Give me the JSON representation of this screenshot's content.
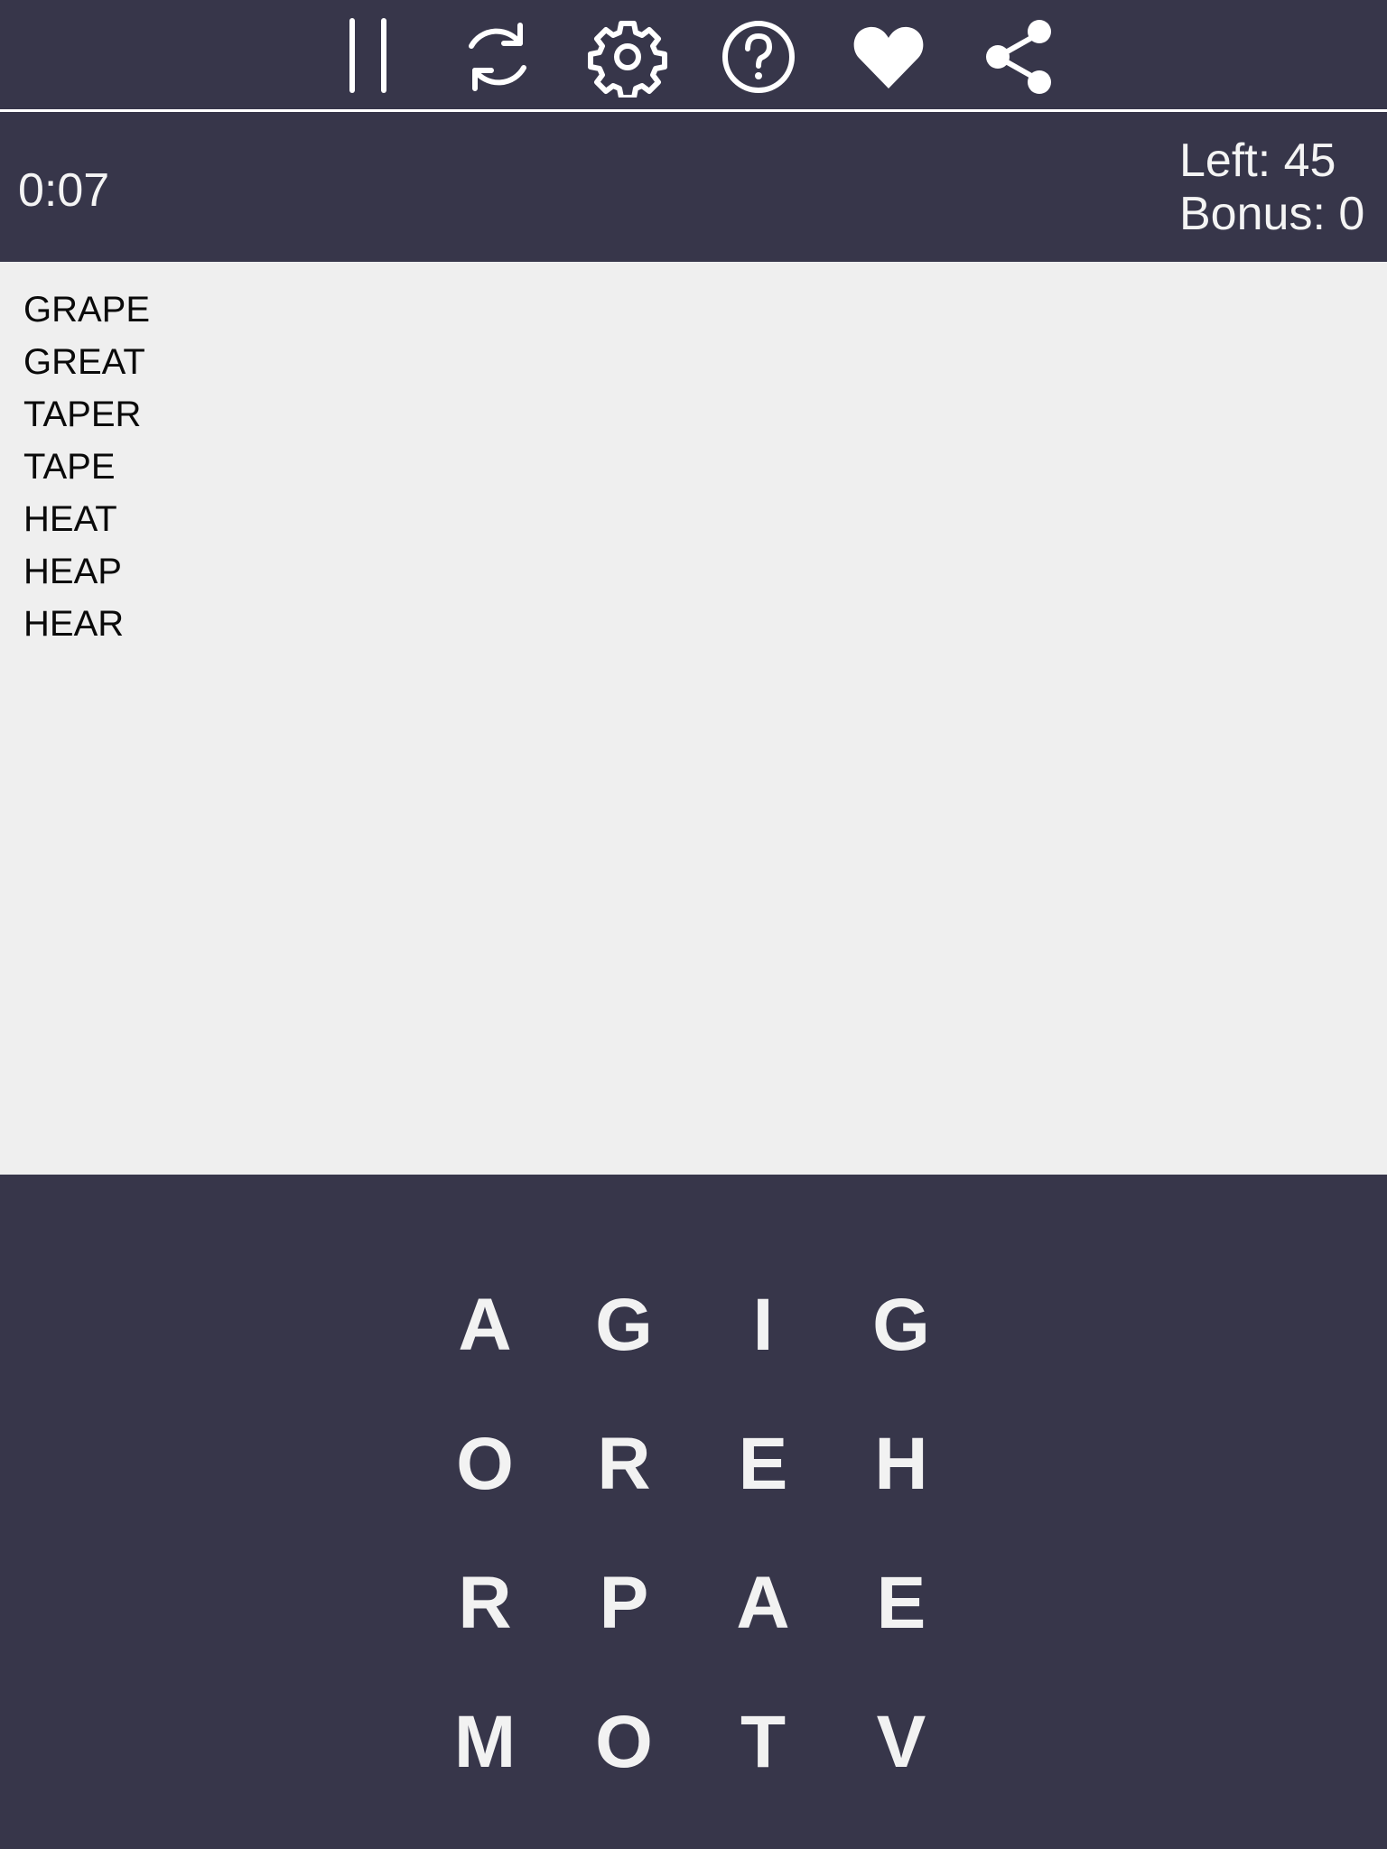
{
  "toolbar": {
    "buttons": [
      {
        "name": "pause-button",
        "icon": "pause-icon"
      },
      {
        "name": "restart-button",
        "icon": "refresh-icon"
      },
      {
        "name": "settings-button",
        "icon": "gear-icon"
      },
      {
        "name": "help-button",
        "icon": "question-icon"
      },
      {
        "name": "favorite-button",
        "icon": "heart-icon"
      },
      {
        "name": "share-button",
        "icon": "share-icon"
      }
    ]
  },
  "status": {
    "timer": "0:07",
    "left": "Left: 45",
    "bonus": "Bonus: 0"
  },
  "found_words": [
    "GRAPE",
    "GREAT",
    "TAPER",
    "TAPE",
    "HEAT",
    "HEAP",
    "HEAR"
  ],
  "grid": [
    [
      "A",
      "G",
      "I",
      "G"
    ],
    [
      "O",
      "R",
      "E",
      "H"
    ],
    [
      "R",
      "P",
      "A",
      "E"
    ],
    [
      "M",
      "O",
      "T",
      "V"
    ]
  ],
  "colors": {
    "dark_background": "#37364a",
    "light_panel": "#efefef",
    "foreground": "#f4f4f4"
  }
}
